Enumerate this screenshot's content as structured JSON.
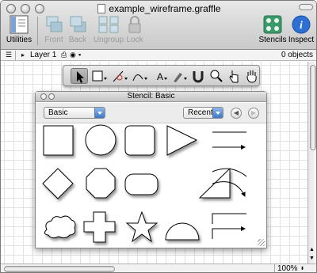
{
  "window": {
    "title": "example_wireframe.graffle"
  },
  "toolbar": {
    "utilities": "Utilities",
    "front": "Front",
    "back": "Back",
    "ungroup": "Ungroup",
    "lock": "Lock",
    "stencils": "Stencils",
    "inspect": "Inspect"
  },
  "layerbar": {
    "layer": "Layer 1",
    "objects": "0 objects"
  },
  "tools": [
    "selection-tool",
    "shape-tool",
    "line-tool",
    "bezier-tool",
    "text-tool",
    "style-brush-tool",
    "magnet-tool",
    "zoom-tool",
    "browse-tool",
    "hand-tool"
  ],
  "stencil": {
    "title": "Stencil: Basic",
    "library": "Basic",
    "sort": "Recent",
    "back_glyph": "◀",
    "forward_glyph": "▶"
  },
  "status": {
    "zoom": "100%"
  },
  "colors": {
    "accent": "#3c78c8",
    "stencils_icon": "#3a9a6a",
    "inspect_icon": "#2e6fd6"
  }
}
